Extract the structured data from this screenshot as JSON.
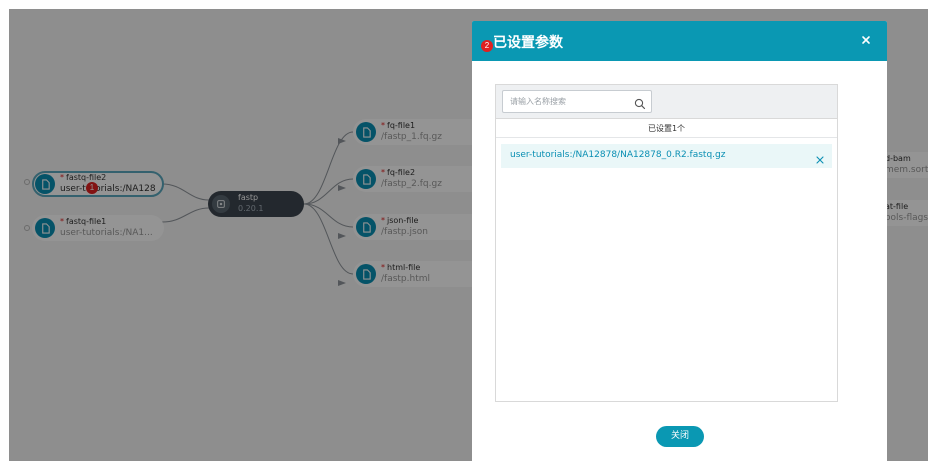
{
  "workflow": {
    "input_nodes": [
      {
        "label": "fastq-file2",
        "path": "user-tutorials:/NA128",
        "required_mark": "*"
      },
      {
        "label": "fastq-file1",
        "path": "user-tutorials:/NA1...",
        "required_mark": "*"
      }
    ],
    "process_node": {
      "name": "fastp",
      "version": "0.20.1"
    },
    "output_nodes": [
      {
        "label": "fq-file1",
        "path": "/fastp_1.fq.gz",
        "required_mark": "*"
      },
      {
        "label": "fq-file2",
        "path": "/fastp_2.fq.gz",
        "required_mark": "*"
      },
      {
        "label": "json-file",
        "path": "/fastp.json",
        "required_mark": "*"
      },
      {
        "label": "html-file",
        "path": "/fastp.html",
        "required_mark": "*"
      }
    ],
    "partial_nodes": [
      {
        "label": "d-bam",
        "path": "mem.sorte"
      },
      {
        "label": "at-file",
        "path": "ools-flagst"
      }
    ],
    "markers": [
      "1",
      "2"
    ]
  },
  "modal": {
    "title": "已设置参数",
    "search_placeholder": "请输入名称搜索",
    "count_label": "已设置1个",
    "items": [
      "user-tutorials:/NA12878/NA12878_0.R2.fastq.gz"
    ],
    "close_button_label": "关闭"
  },
  "colors": {
    "accent": "#0a98b3",
    "node_icon": "#0a8fb3",
    "process_node": "#3d4650",
    "marker": "#e02020"
  }
}
